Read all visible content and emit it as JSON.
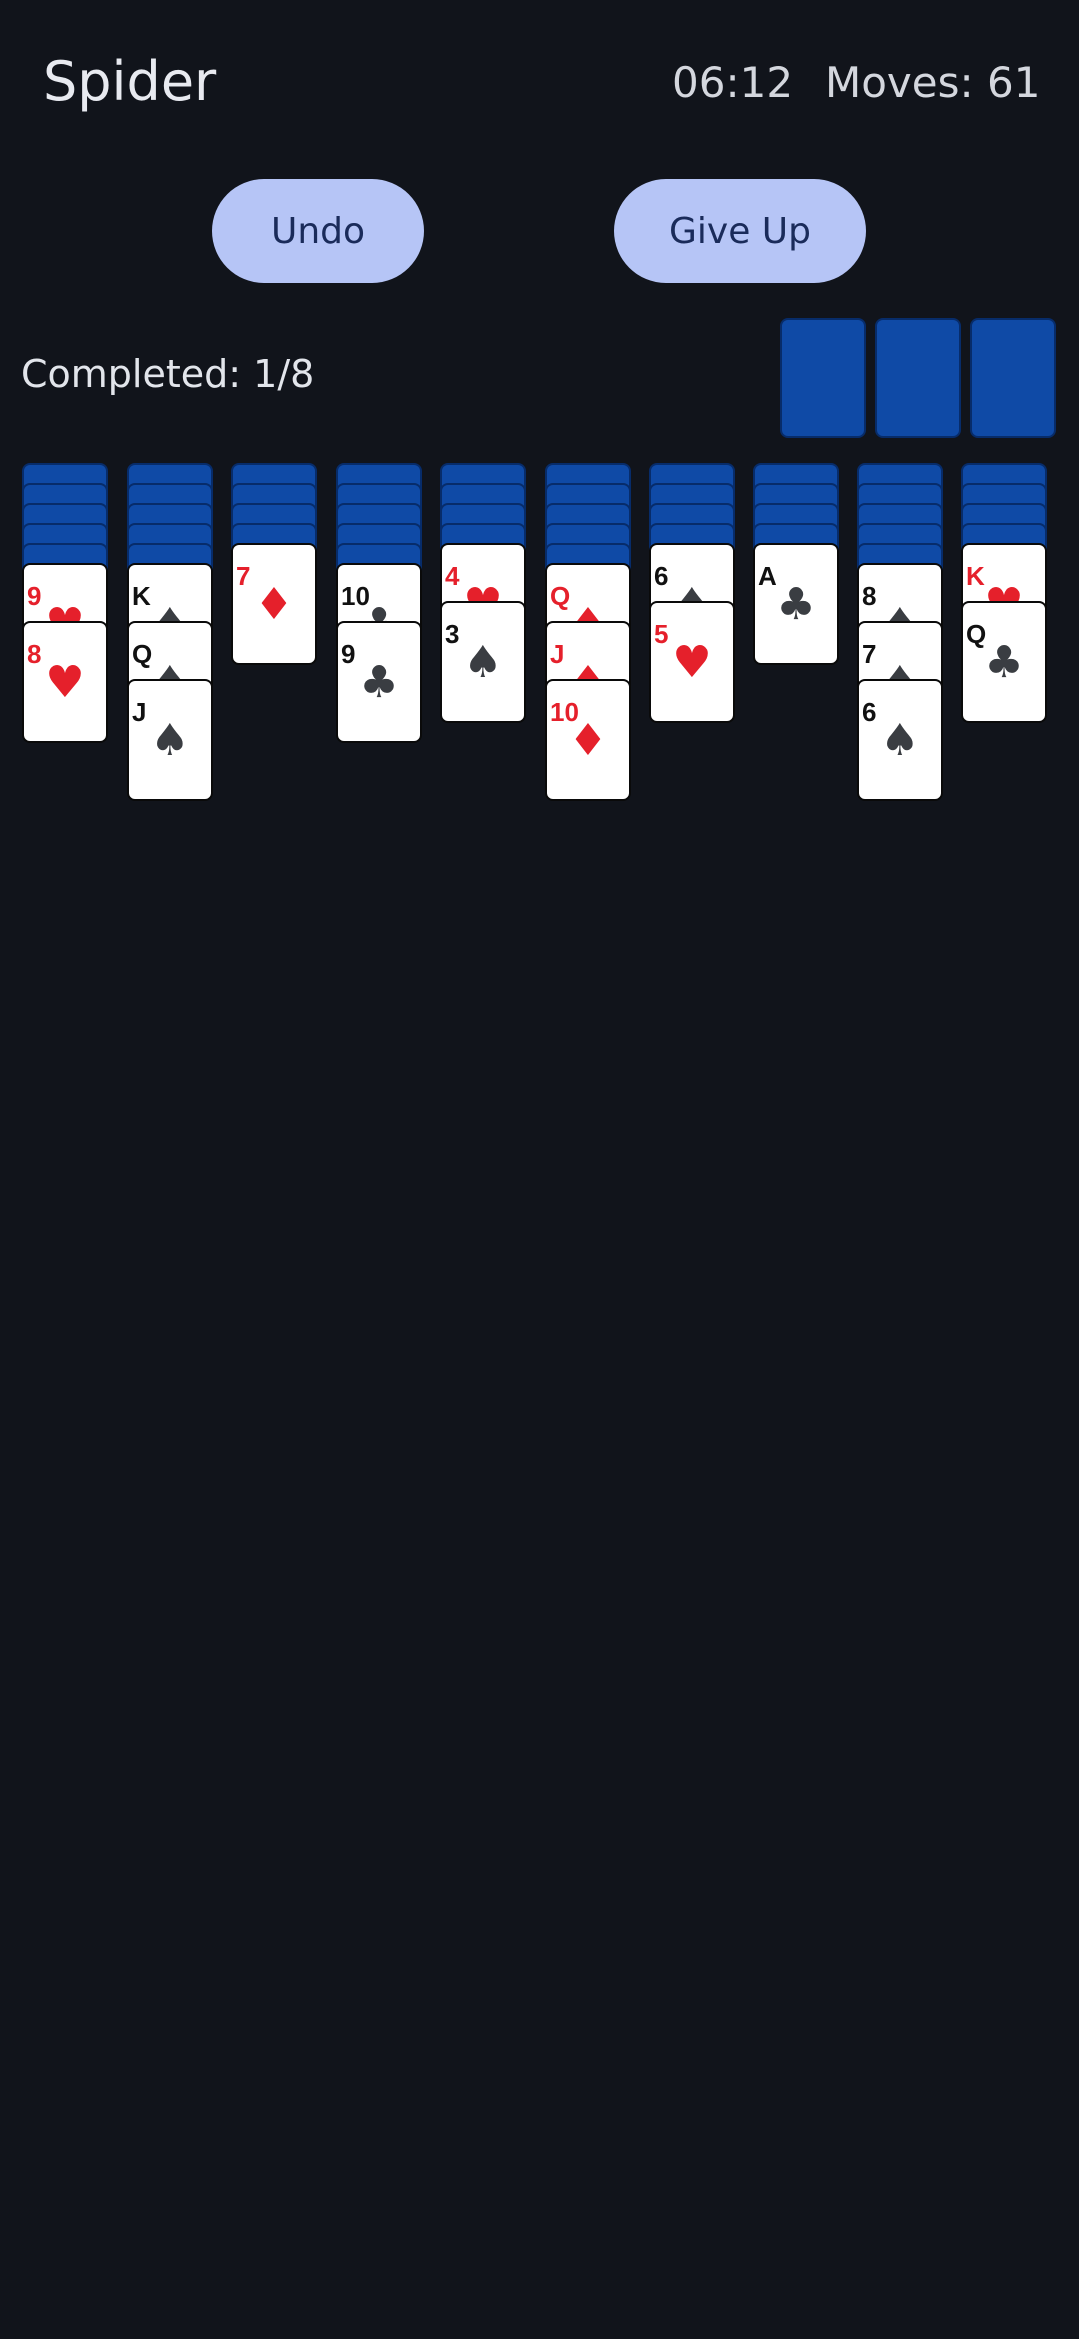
{
  "header": {
    "title": "Spider",
    "timer": "06:12",
    "moves": "Moves: 61"
  },
  "buttons": {
    "undo": "Undo",
    "give_up": "Give Up"
  },
  "status": {
    "completed": "Completed: 1/8"
  },
  "stock_piles": 3,
  "colors": {
    "background": "#11141b",
    "button_bg": "#b6c5f6",
    "card_back": "#0f4aa6",
    "red_suit": "#e5202b",
    "black_suit": "#3a3d42"
  },
  "tableau": [
    {
      "face_down": 5,
      "cards": [
        {
          "rank": "9",
          "suit": "♥",
          "color": "red"
        },
        {
          "rank": "8",
          "suit": "♥",
          "color": "red"
        }
      ]
    },
    {
      "face_down": 5,
      "cards": [
        {
          "rank": "K",
          "suit": "♠",
          "color": "black"
        },
        {
          "rank": "Q",
          "suit": "♠",
          "color": "black"
        },
        {
          "rank": "J",
          "suit": "♠",
          "color": "black"
        }
      ]
    },
    {
      "face_down": 4,
      "cards": [
        {
          "rank": "7",
          "suit": "♦",
          "color": "red"
        }
      ]
    },
    {
      "face_down": 5,
      "cards": [
        {
          "rank": "10",
          "suit": "♣",
          "color": "black"
        },
        {
          "rank": "9",
          "suit": "♣",
          "color": "black"
        }
      ]
    },
    {
      "face_down": 4,
      "cards": [
        {
          "rank": "4",
          "suit": "♥",
          "color": "red"
        },
        {
          "rank": "3",
          "suit": "♠",
          "color": "black"
        }
      ]
    },
    {
      "face_down": 5,
      "cards": [
        {
          "rank": "Q",
          "suit": "♦",
          "color": "red"
        },
        {
          "rank": "J",
          "suit": "♦",
          "color": "red"
        },
        {
          "rank": "10",
          "suit": "♦",
          "color": "red"
        }
      ]
    },
    {
      "face_down": 4,
      "cards": [
        {
          "rank": "6",
          "suit": "♠",
          "color": "black"
        },
        {
          "rank": "5",
          "suit": "♥",
          "color": "red"
        }
      ]
    },
    {
      "face_down": 4,
      "cards": [
        {
          "rank": "A",
          "suit": "♣",
          "color": "black"
        }
      ]
    },
    {
      "face_down": 5,
      "cards": [
        {
          "rank": "8",
          "suit": "♠",
          "color": "black"
        },
        {
          "rank": "7",
          "suit": "♠",
          "color": "black"
        },
        {
          "rank": "6",
          "suit": "♠",
          "color": "black"
        }
      ]
    },
    {
      "face_down": 4,
      "cards": [
        {
          "rank": "K",
          "suit": "♥",
          "color": "red"
        },
        {
          "rank": "Q",
          "suit": "♣",
          "color": "black"
        }
      ]
    }
  ]
}
